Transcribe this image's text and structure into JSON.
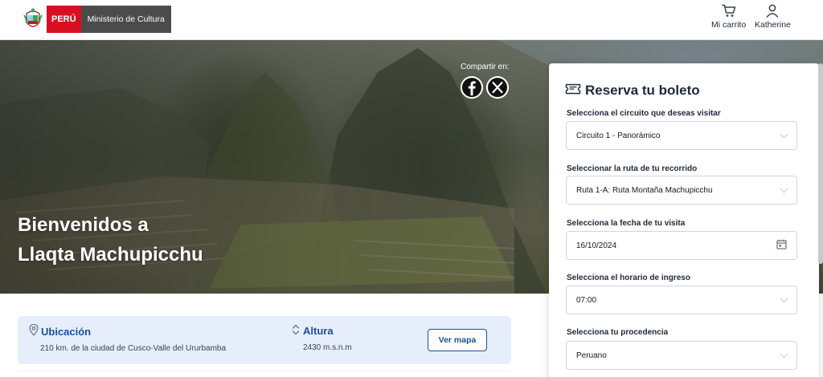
{
  "header": {
    "brand": {
      "country": "PERÚ",
      "ministry": "Ministerio de Cultura"
    },
    "cart": {
      "label": "Mi carrito",
      "icon": "cart-icon"
    },
    "user": {
      "label": "Katherine",
      "icon": "user-icon"
    }
  },
  "hero": {
    "title_line1": "Bienvenidos a",
    "title_line2": "Llaqta Machupicchu",
    "share_label": "Compartir en:",
    "share_icons": [
      "facebook-icon",
      "x-icon"
    ]
  },
  "info": {
    "location": {
      "title": "Ubicación",
      "value": "210 km. de la ciudad de Cusco-Valle del Ururbamba",
      "icon": "location-pin-icon"
    },
    "altitude": {
      "title": "Altura",
      "value": "2430 m.s.n.m",
      "icon": "altitude-icon"
    },
    "map_button": "Ver mapa"
  },
  "booking": {
    "title": "Reserva tu boleto",
    "circuit": {
      "label": "Selecciona el circuito que deseas visitar",
      "value": "Circuito 1 - Panorámico"
    },
    "route": {
      "label": "Seleccionar la ruta de tu recorrido",
      "value": "Ruta 1-A: Ruta Montaña Machupicchu"
    },
    "date": {
      "label": "Selecciona la fecha de tu visita",
      "value": "16/10/2024",
      "icon": "calendar-icon"
    },
    "time": {
      "label": "Selecciona el horario de ingreso",
      "value": "07:00"
    },
    "origin": {
      "label": "Selecciona tu procedencia",
      "value": "Peruano"
    }
  },
  "colors": {
    "accent": "#1d4f9a",
    "brand_red": "#d91023",
    "info_bg": "#e6eefb"
  }
}
